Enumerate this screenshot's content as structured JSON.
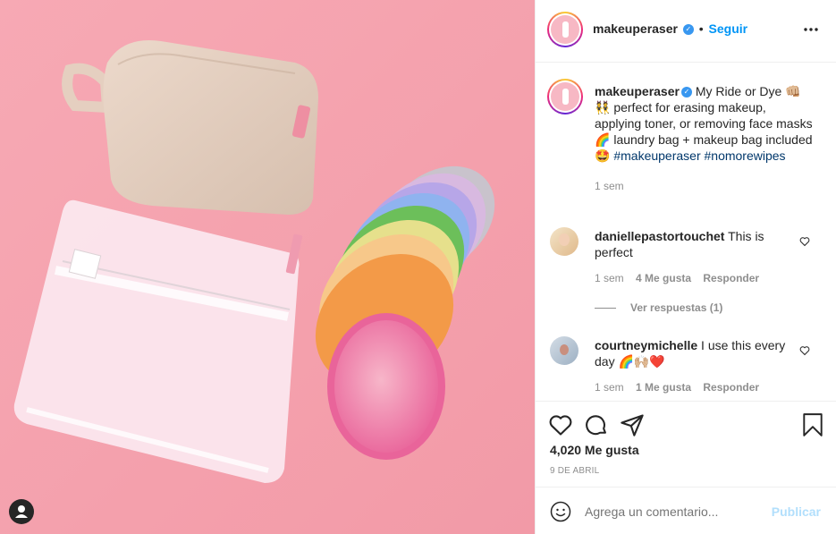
{
  "header": {
    "username": "makeuperaser",
    "dot": "•",
    "follow_label": "Seguir",
    "more_icon": "more-horizontal-icon"
  },
  "caption": {
    "username": "makeuperaser",
    "text_1": " My Ride or Dye ",
    "emoji_1": "👊🏼",
    "text_2": " ",
    "emoji_2": "👯",
    "text_3": " perfect for erasing makeup, applying toner, or removing face masks ",
    "emoji_3": "🌈",
    "text_4": " laundry bag + makeup bag included ",
    "emoji_4": "🤩",
    "text_5": " ",
    "hashtag_1": "#makeuperaser",
    "text_6": " ",
    "hashtag_2": "#nomorewipes",
    "time": "1 sem"
  },
  "comments": [
    {
      "username": "daniellepastortouchet",
      "text": " This is perfect",
      "emoji": "",
      "time": "1 sem",
      "likes": "4 Me gusta",
      "reply": "Responder",
      "view_replies": "Ver respuestas (1)"
    },
    {
      "username": "courtneymichelle",
      "text": " I use this every day ",
      "emoji": "🌈🙌🏼❤️",
      "time": "1 sem",
      "likes": "1 Me gusta",
      "reply": "Responder"
    }
  ],
  "actions": {
    "likes_count": "4,020 Me gusta",
    "date": "9 DE ABRIL"
  },
  "comment_box": {
    "placeholder": "Agrega un comentario...",
    "publish_label": "Publicar"
  },
  "colors": {
    "photo_bg": "#f4a3ae",
    "link_blue": "#00376b",
    "follow_blue": "#0095f6",
    "publish_blue_disabled": "#b2dffc",
    "meta_gray": "#8e8e8e"
  }
}
